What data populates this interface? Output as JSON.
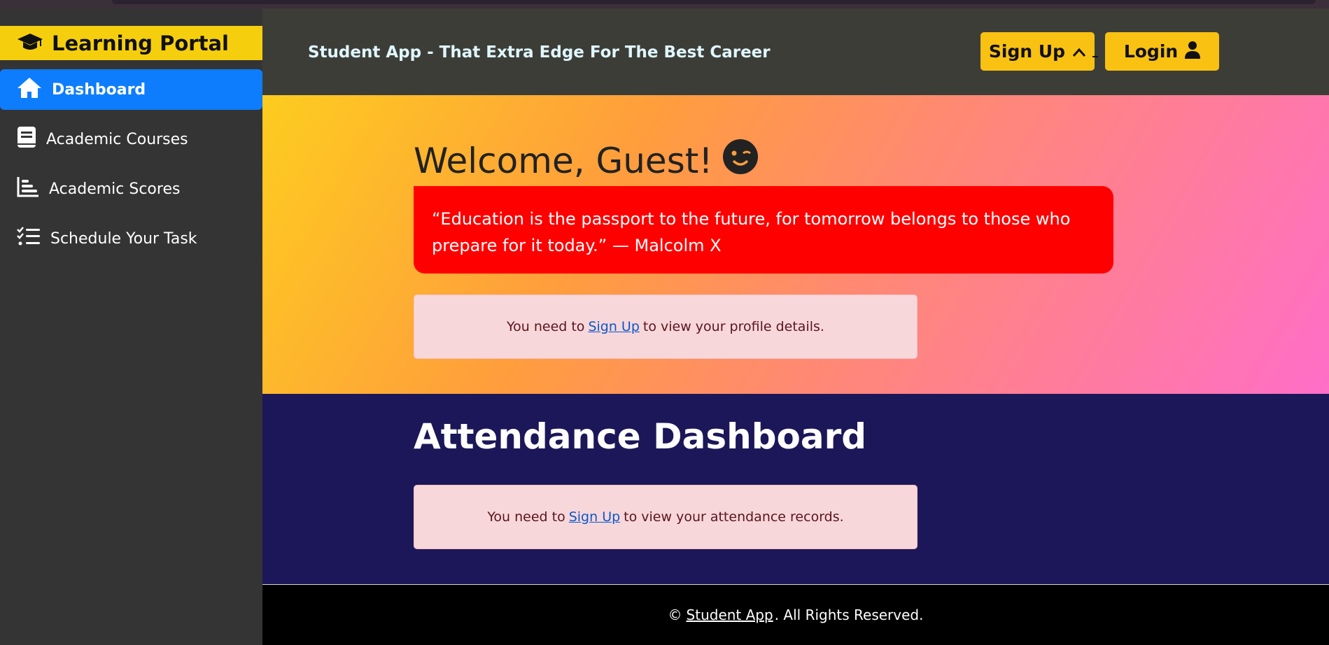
{
  "sidebar": {
    "brand": "Learning Portal",
    "items": [
      {
        "label": "Dashboard",
        "icon": "home-icon",
        "active": true
      },
      {
        "label": "Academic Courses",
        "icon": "book-icon"
      },
      {
        "label": "Academic Scores",
        "icon": "bar-chart-icon"
      },
      {
        "label": "Schedule Your Task",
        "icon": "task-list-icon"
      }
    ]
  },
  "header": {
    "title": "Student App - That Extra Edge For The Best Career",
    "signup_label": "Sign Up",
    "login_label": "Login"
  },
  "hero": {
    "welcome": "Welcome, Guest!",
    "quote": "“Education is the passport to the future, for tomorrow belongs to those who prepare for it today.” — Malcolm X",
    "profile_notice": {
      "before": "You need to",
      "link": "Sign Up",
      "after": "to view your profile details."
    }
  },
  "attendance": {
    "title": "Attendance Dashboard",
    "notice": {
      "before": "You need to",
      "link": "Sign Up",
      "after": "to view your attendance records."
    }
  },
  "footer": {
    "prefix": "©",
    "link": "Student App",
    "suffix": ". All Rights Reserved."
  },
  "colors": {
    "brand_bg": "#f5cf0e",
    "active_nav": "#0d7dfd",
    "button_yellow": "#f9c112",
    "quote_red": "#ff0000",
    "attendance_bg": "#1c1758",
    "notice_bg": "#f8d7da"
  }
}
